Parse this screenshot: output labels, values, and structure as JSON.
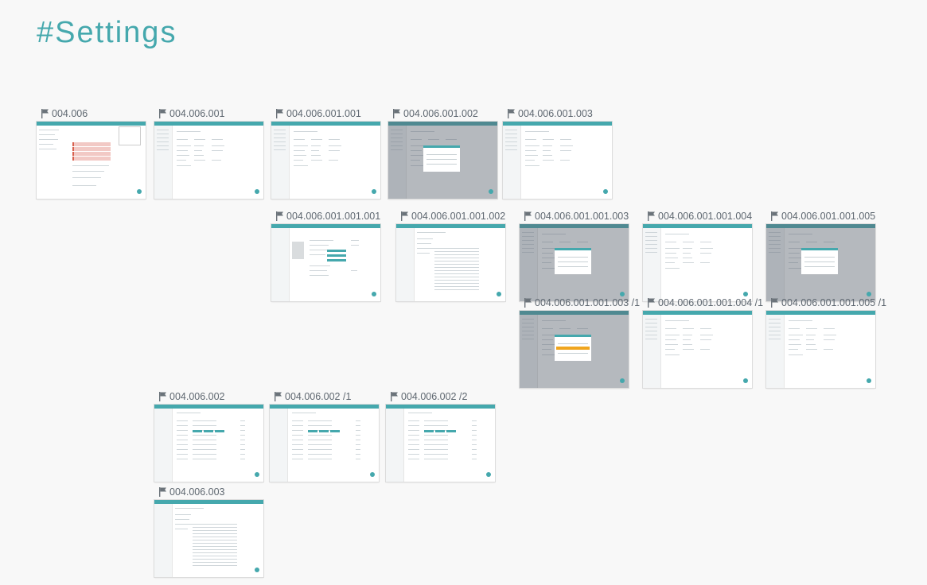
{
  "title": "#Settings",
  "cards": [
    {
      "id": "004.006",
      "variant": "calendar"
    },
    {
      "id": "004.006.001",
      "variant": "list"
    },
    {
      "id": "004.006.001.001",
      "variant": "list"
    },
    {
      "id": "004.006.001.002",
      "variant": "modal"
    },
    {
      "id": "004.006.001.003",
      "variant": "list"
    },
    {
      "id": "004.006.001.001.001",
      "variant": "profile"
    },
    {
      "id": "004.006.001.001.002",
      "variant": "document"
    },
    {
      "id": "004.006.001.001.003",
      "variant": "modal"
    },
    {
      "id": "004.006.001.001.004",
      "variant": "list"
    },
    {
      "id": "004.006.001.001.005",
      "variant": "modal"
    },
    {
      "id": "004.006.001.001.003 /1",
      "variant": "modal-orange"
    },
    {
      "id": "004.006.001.001.004 /1",
      "variant": "list"
    },
    {
      "id": "004.006.001.001.005 /1",
      "variant": "list"
    },
    {
      "id": "004.006.002",
      "variant": "form"
    },
    {
      "id": "004.006.002 /1",
      "variant": "form"
    },
    {
      "id": "004.006.002 /2",
      "variant": "form"
    },
    {
      "id": "004.006.003",
      "variant": "document"
    }
  ]
}
